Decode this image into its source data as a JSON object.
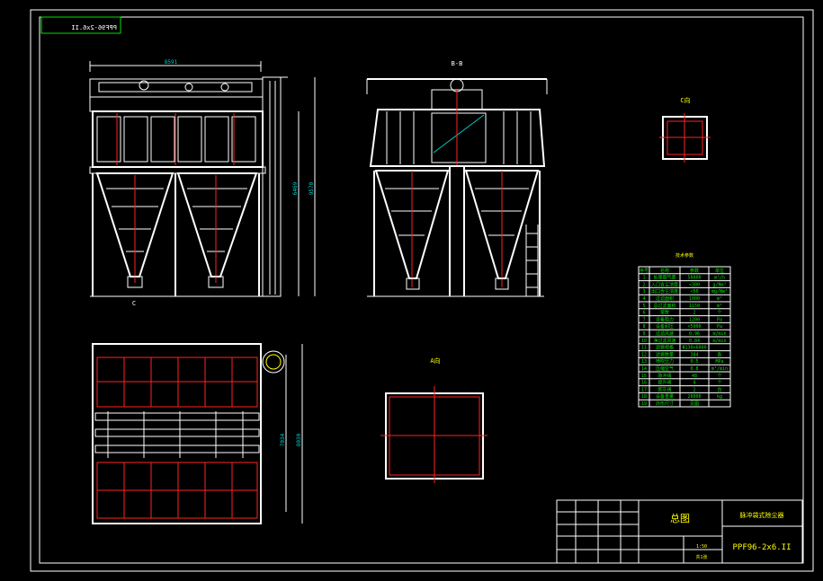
{
  "drawing_code_mirrored": "PPF96-2x6.II",
  "front_view": {
    "width_dim": "8591",
    "height_dim_inner": "6469",
    "height_dim_outer": "9570",
    "section_mark": "C"
  },
  "section_bb_title": "B-B",
  "detail_c_title": "C向",
  "plan_view": {
    "height_dim_inner": "7034",
    "height_dim_outer": "8030"
  },
  "view_a_title": "A向",
  "param_table": {
    "title": "技术参数",
    "headers": [
      "序号",
      "名称",
      "参数",
      "单位"
    ],
    "rows": [
      [
        "1",
        "处理烟气量",
        "58000",
        "m³/h"
      ],
      [
        "2",
        "入口含尘浓度",
        "<300",
        "g/Nm³"
      ],
      [
        "3",
        "出口含尘浓度",
        "<50",
        "mg/Nm³"
      ],
      [
        "4",
        "过滤面积",
        "1000",
        "m²"
      ],
      [
        "5",
        "总过滤面积",
        "1150",
        "m²"
      ],
      [
        "6",
        "室数",
        "2",
        "个"
      ],
      [
        "7",
        "设备阻力",
        "1200",
        "Pa"
      ],
      [
        "8",
        "设备耐压",
        "<5000",
        "Pa"
      ],
      [
        "9",
        "过滤风速",
        "0.96",
        "m/min"
      ],
      [
        "10",
        "净过滤风速",
        "0.84",
        "m/min"
      ],
      [
        "11",
        "滤袋规格",
        "Φ130×6000",
        ""
      ],
      [
        "12",
        "滤袋数量",
        "384",
        "条"
      ],
      [
        "13",
        "喷吹压力",
        "0.5",
        "MPa"
      ],
      [
        "14",
        "压缩空气",
        "0.8",
        "m³/min"
      ],
      [
        "15",
        "脉冲阀",
        "48",
        "个"
      ],
      [
        "16",
        "提升阀",
        "4",
        "个"
      ],
      [
        "17",
        "卸灰阀",
        "2",
        "台"
      ],
      [
        "18",
        "设备重量",
        "28000",
        "kg"
      ],
      [
        "19",
        "外形尺寸",
        "见图",
        ""
      ]
    ]
  },
  "title_block": {
    "drawing_name": "总图",
    "product_name": "脉冲袋式除尘器",
    "drawing_code": "PPF96-2x6.II",
    "scale": "1:50",
    "sheet": "共1张"
  }
}
